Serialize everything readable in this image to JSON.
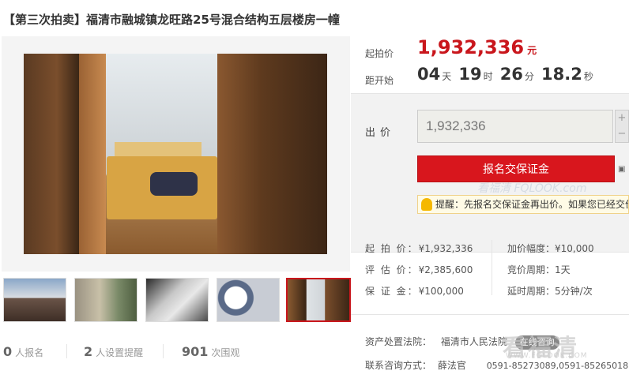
{
  "title": "【第三次拍卖】福清市融城镇龙旺路25号混合结构五层楼房一幢",
  "price": {
    "start_label": "起拍价",
    "start_value": "1,932,336",
    "unit": "元",
    "countdown_label": "距开始",
    "countdown": [
      {
        "value": "04",
        "unit": "天"
      },
      {
        "value": "19",
        "unit": "时"
      },
      {
        "value": "26",
        "unit": "分"
      },
      {
        "value": "18.2",
        "unit": "秒"
      }
    ]
  },
  "bid": {
    "label": "出价",
    "value": "1,932,336",
    "plus": "+",
    "minus": "−",
    "enroll_button": "报名交保证金",
    "tip": "提醒：先报名交保证金再出价。如果您已经交价"
  },
  "details_left": [
    {
      "key": "起 拍 价：",
      "value": "¥1,932,336"
    },
    {
      "key": "评 估 价：",
      "value": "¥2,385,600"
    },
    {
      "key": "保 证 金：",
      "value": "¥100,000"
    }
  ],
  "details_right": [
    {
      "key": "加价幅度：",
      "value": "¥10,000"
    },
    {
      "key": "竞价周期：",
      "value": "1天"
    },
    {
      "key": "延时周期：",
      "value": "5分钟/次"
    }
  ],
  "court": {
    "label": "资产处置法院：",
    "name": "福清市人民法院",
    "tag": "在线咨询"
  },
  "contact": {
    "label": "联系咨询方式：",
    "name": "薛法官",
    "phone": "0591-85273089,0591-85265018"
  },
  "stats": [
    {
      "num": "0",
      "label": "人报名"
    },
    {
      "num": "2",
      "label": "人设置提醒"
    },
    {
      "num": "901",
      "label": "次围观"
    }
  ],
  "watermark": {
    "main": "看福清",
    "sub": "WWW.FQLOOK.COM",
    "overlay": "看福清 FQLOOK.com"
  },
  "colors": {
    "accent": "#c9161c",
    "button": "#d8161d"
  }
}
